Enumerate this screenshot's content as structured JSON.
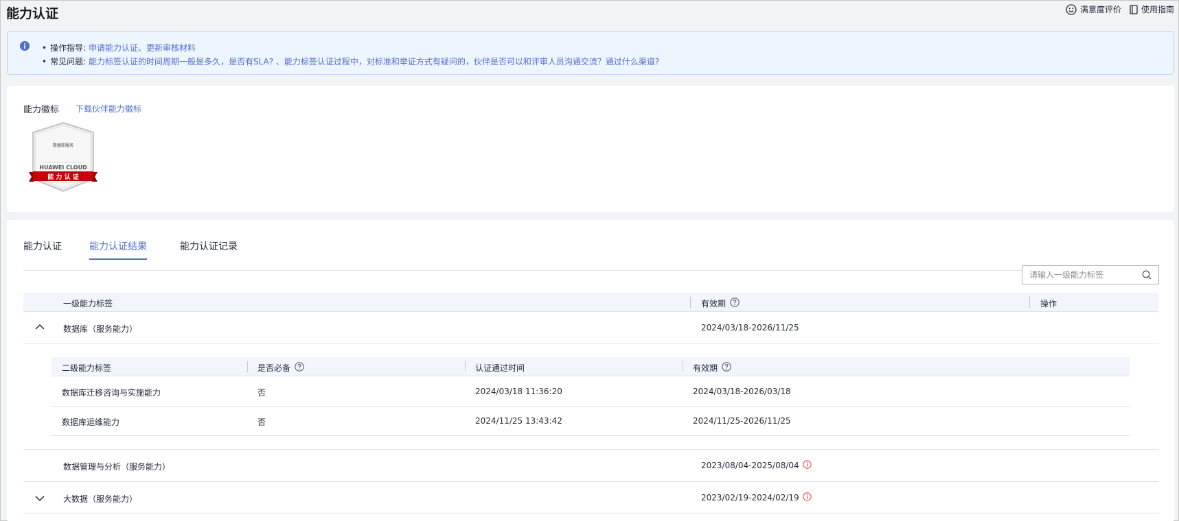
{
  "page": {
    "title": "能力认证"
  },
  "top_links": {
    "feedback": "满意度评价",
    "guide": "使用指南"
  },
  "guide_box": {
    "row1_label": "操作指导:",
    "row1_links": "申请能力认证、更新审核材料",
    "row2_label": "常见问题:",
    "row2_links": "能力标签认证的时间周期一般是多久，是否有SLA? 、能力标签认证过程中，对标准和举证方式有疑问的，伙伴是否可以和评审人员沟通交流？通过什么渠道?"
  },
  "badge_section": {
    "title": "能力徽标",
    "download_link": "下载伙伴能力徽标",
    "badge": {
      "category": "数据库服务",
      "brand": "HUAWEI CLOUD",
      "ribbon": "能 力 认 证"
    }
  },
  "tabs": [
    {
      "label": "能力认证"
    },
    {
      "label": "能力认证结果"
    },
    {
      "label": "能力认证记录"
    }
  ],
  "search": {
    "placeholder": "请输入一级能力标签"
  },
  "table": {
    "headers": {
      "level1": "一级能力标签",
      "validity": "有效期",
      "action": "操作"
    },
    "rows": [
      {
        "name": "数据库（服务能力）",
        "validity": "2024/03/18-2026/11/25",
        "expanded": true
      },
      {
        "name": "数据管理与分析（服务能力）",
        "validity": "2023/08/04-2025/08/04",
        "warning": true
      },
      {
        "name": "大数据（服务能力）",
        "validity": "2023/02/19-2024/02/19",
        "warning": true
      }
    ]
  },
  "subtable": {
    "headers": {
      "level2": "二级能力标签",
      "required": "是否必备",
      "passed_time": "认证通过时间",
      "validity": "有效期"
    },
    "rows": [
      {
        "name": "数据库迁移咨询与实施能力",
        "required": "否",
        "passed_time": "2024/03/18 11:36:20",
        "validity": "2024/03/18-2026/03/18"
      },
      {
        "name": "数据库运维能力",
        "required": "否",
        "passed_time": "2024/11/25 13:43:42",
        "validity": "2024/11/25-2026/11/25"
      }
    ]
  },
  "colors": {
    "accent": "#526ecc",
    "warning": "#e84a4a",
    "ribbon": "#c7000b"
  }
}
